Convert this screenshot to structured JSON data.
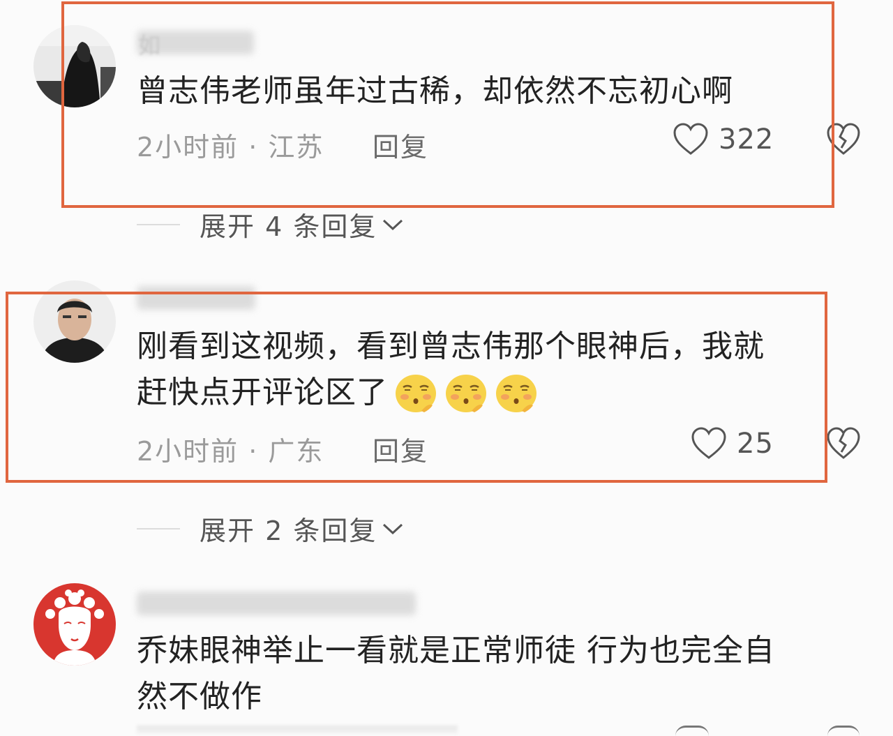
{
  "comments": [
    {
      "username": "如",
      "text_lines": [
        "曾志伟老师虽年过古稀，却依然不忘初心啊"
      ],
      "time_location": "2小时前 · 江苏",
      "reply_label": "回复",
      "likes": "322",
      "expand_label": "展开 4 条回复"
    },
    {
      "username": "",
      "text_lines": [
        "刚看到这视频，看到曾志伟那个眼神后，我就",
        "赶快点开评论区了"
      ],
      "time_location": "2小时前 · 广东",
      "reply_label": "回复",
      "likes": "25",
      "expand_label": "展开 2 条回复"
    },
    {
      "username": "",
      "text_lines": [
        "乔妹眼神举止一看就是正常师徒 行为也完全自",
        "然不做作"
      ],
      "time_location": "",
      "reply_label": "",
      "likes": ""
    }
  ],
  "icons": {
    "like": "heart-outline-icon",
    "dislike": "broken-heart-icon",
    "expand": "chevron-down-icon",
    "emoji": "shy-face-emoji"
  },
  "colors": {
    "highlight": "#e0663f",
    "meta_text": "#9a9a9a",
    "emoji_yellow": "#f7d24a"
  }
}
